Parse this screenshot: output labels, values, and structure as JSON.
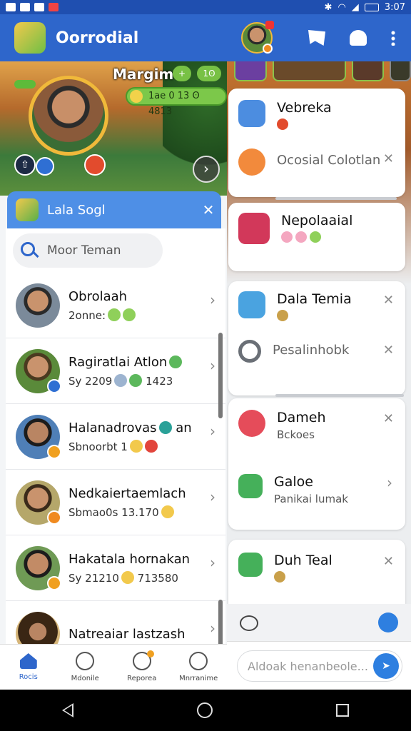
{
  "status_bar": {
    "time": "3:07"
  },
  "left": {
    "app_title": "Oorrodial",
    "game": {
      "title": "Margim",
      "score": "1ae 0 13 ʘ 4813",
      "pill_a": "+",
      "pill_b": "1ʘ"
    },
    "panel": {
      "title": "Lala Sogl",
      "search_placeholder": "Moor Teman"
    },
    "contacts": [
      {
        "name": "Obrolaah",
        "meta": "2onne:",
        "dot_color": ""
      },
      {
        "name": "Ragiratlai Atlon",
        "meta": "Sy 2209",
        "meta2": "1423",
        "dot_color": "#2f6fd3"
      },
      {
        "name": "Halanadrovas",
        "name_suffix": "an",
        "meta": "Sbnoorbt 1",
        "dot_color": "#f0a020"
      },
      {
        "name": "Nedkaiertaemlach",
        "meta": "Sbmao0s 13.170",
        "dot_color": "#f08a20"
      },
      {
        "name": "Hakatala hornakan",
        "meta": "Sy 21210",
        "meta2": "713580",
        "dot_color": "#f0a020"
      },
      {
        "name": "Natreaiar lastzash",
        "meta": "",
        "dot_color": ""
      }
    ],
    "nav": [
      {
        "label": "Rocis"
      },
      {
        "label": "Mdonile"
      },
      {
        "label": "Reporea"
      },
      {
        "label": "Mnrranime"
      }
    ]
  },
  "right": {
    "items": [
      {
        "title": "Vebreka",
        "icon_color": "#4c8de0"
      },
      {
        "title": "Ocosial Colotlan",
        "icon_color": "#f28a3c"
      },
      {
        "title": "Nepolaaial",
        "icon_color": "#d2385a"
      },
      {
        "title": "Dala Temia",
        "icon_color": "#4aa3e0"
      },
      {
        "title": "Pesalinhobk",
        "icon_color": "#6a6f76"
      },
      {
        "title": "Dameh",
        "sub": "Bckoes",
        "icon_color": "#e54c5a"
      },
      {
        "title": "Galoe",
        "sub": "Panikai lumak",
        "icon_color": "#45b05a"
      },
      {
        "title": "Duh Teal",
        "icon_color": "#45b05a"
      }
    ],
    "composer_placeholder": "Aldoak henanbeole..."
  }
}
